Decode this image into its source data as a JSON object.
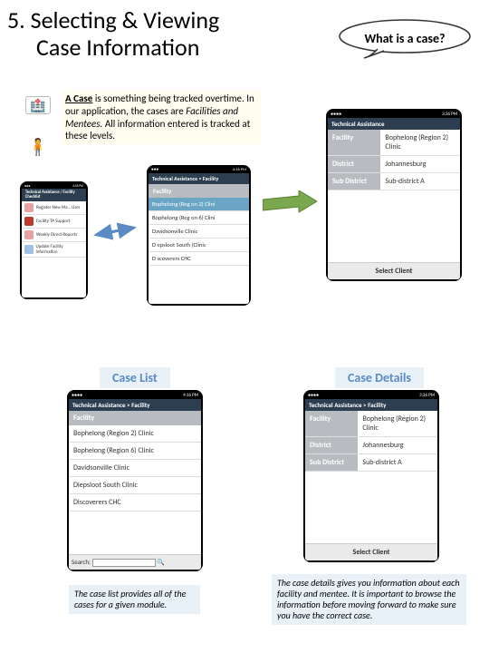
{
  "title_l1": "5. Selecting & Viewing",
  "title_l2": "Case Information",
  "bubble": "What is a case?",
  "definition": {
    "lead": "A Case",
    "rest": " is something being tracked overtime. In our application, the cases are ",
    "emph": "Facilities and Mentees.",
    "tail": " All information entered is tracked at these levels."
  },
  "status_time": "4:16 PM",
  "status_time2": "3:36 PM",
  "carrier": "",
  "mini": {
    "nav": "Technical Assistance / Facility Checklist",
    "items": [
      "Register New Ma… User",
      "Facility TA Support",
      "Weekly Direct Reports",
      "Update Facility Information"
    ]
  },
  "mid": {
    "nav": "Technical Assistance > Facility",
    "hdr": "Facility",
    "items": [
      "Bophelong (Reg on 2) Clini",
      "Bophelong (Reg on 6) Clini",
      "Davidsonville Clinic",
      "D epsloot South (Clinic",
      "D scoverers CHC"
    ]
  },
  "right": {
    "nav": "Technical Assistance",
    "rows": [
      {
        "lbl": "Facility",
        "val": "Bophelong (Region 2) Clinic"
      },
      {
        "lbl": "District",
        "val": "Johannesburg"
      },
      {
        "lbl": "Sub District",
        "val": "Sub-district A"
      }
    ],
    "btn": "Select Client"
  },
  "bl": {
    "nav": "Technical Assistance > Facility",
    "hdr": "Facility",
    "items": [
      "Bophelong (Region 2) Clinic",
      "Bophelong (Region 6) Clinic",
      "Davidsonville Clinic",
      "Diepsloot South Clinic",
      "Discoverers CHC"
    ],
    "search": "Search:"
  },
  "br": {
    "nav": "Technical Assistance > Facility",
    "rows": [
      {
        "lbl": "Facility",
        "val": "Bophelong (Region 2) Clinic"
      },
      {
        "lbl": "District",
        "val": "Johannesburg"
      },
      {
        "lbl": "Sub District",
        "val": "Sub-district A"
      }
    ],
    "btn": "Select Client"
  },
  "labels": {
    "list": "Case List",
    "details": "Case Details"
  },
  "captions": {
    "list": "The case list provides all of the cases for a given module.",
    "details": "The case details gives you information about each facility and mentee. It is important to browse the information before moving forward to make sure you have the correct case."
  }
}
